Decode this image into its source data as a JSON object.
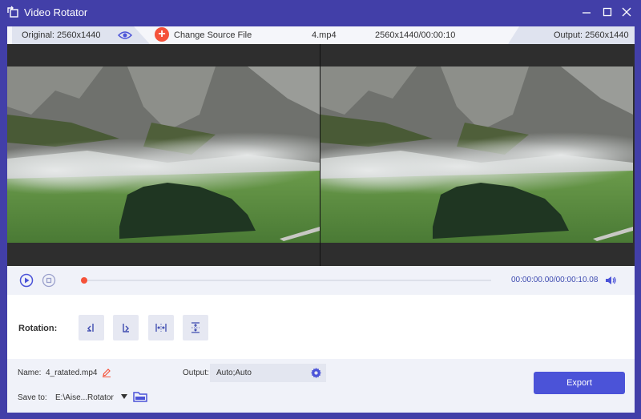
{
  "window": {
    "title": "Video Rotator"
  },
  "infobar": {
    "original_label": "Original: 2560x1440",
    "change_source_label": "Change Source File",
    "file_name": "4.mp4",
    "file_info": "2560x1440/00:00:10",
    "output_label": "Output: 2560x1440"
  },
  "playback": {
    "time_display": "00:00:00.00/00:00:10.08",
    "progress_fraction": 0.0
  },
  "rotation": {
    "label": "Rotation:",
    "buttons": [
      "rotate-left",
      "rotate-right",
      "flip-horizontal",
      "flip-vertical"
    ]
  },
  "settings": {
    "name_label": "Name:",
    "name_value": "4_ratated.mp4",
    "output_label": "Output:",
    "output_value": "Auto;Auto",
    "save_label": "Save to:",
    "save_path": "E:\\Aise...Rotator",
    "export_label": "Export"
  },
  "colors": {
    "brand": "#423fa8",
    "accent": "#f5523a",
    "export": "#4b53d8",
    "time_text": "#3e4bb0"
  }
}
